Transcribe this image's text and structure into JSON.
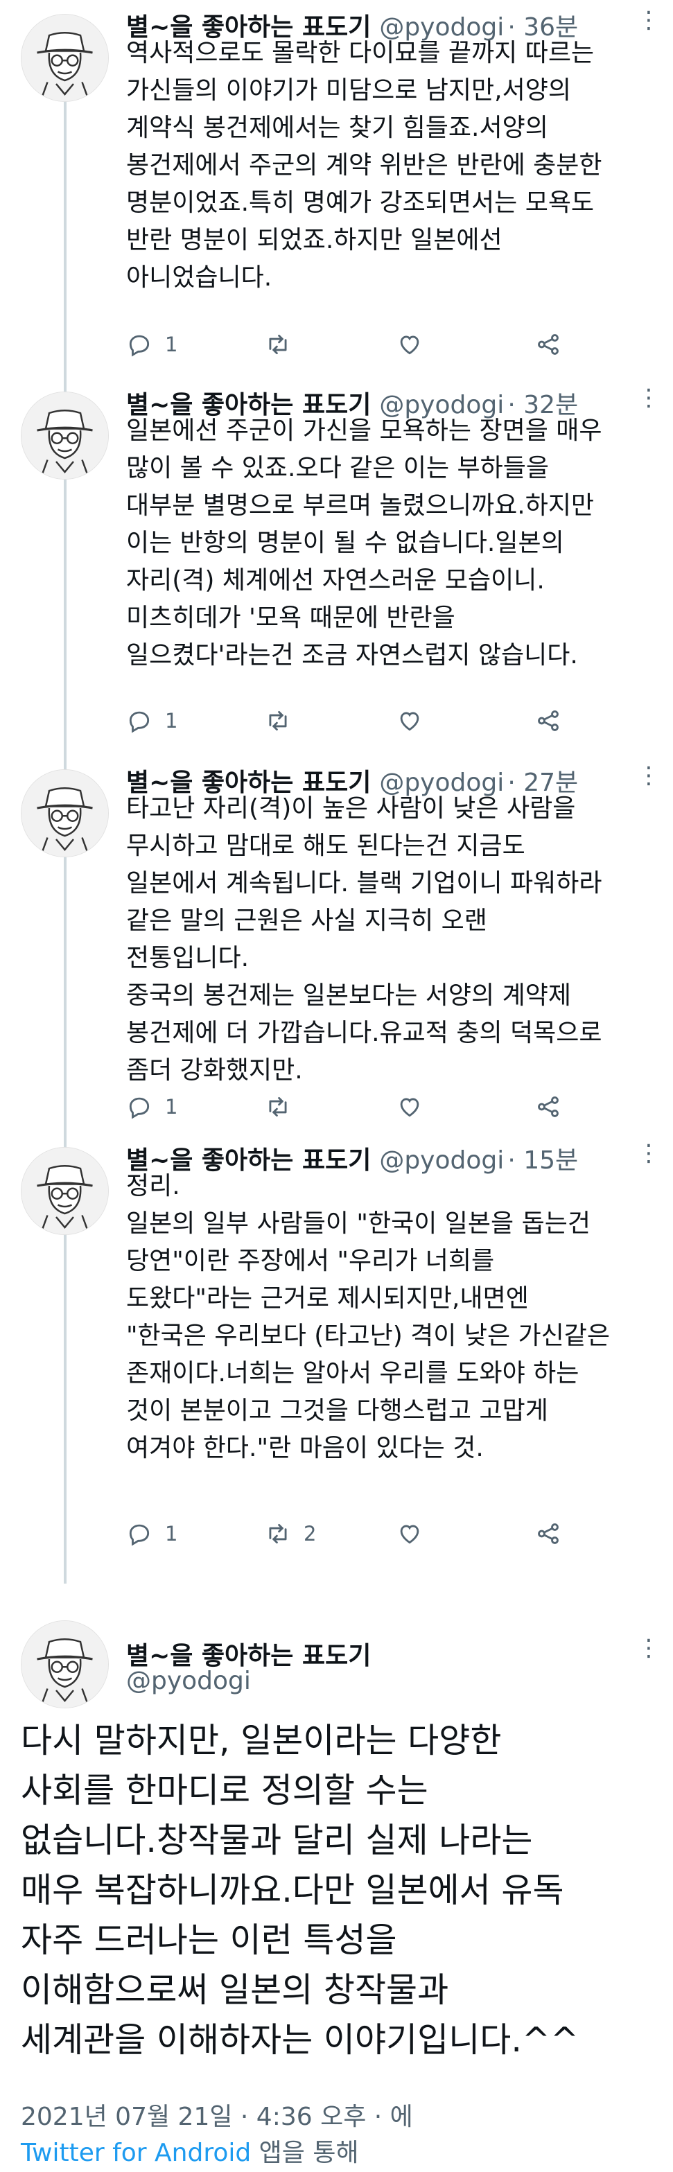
{
  "author": {
    "name": "별~을 좋아하는 표도기",
    "handle": "@pyodogi"
  },
  "tweets": [
    {
      "time": "· 36분",
      "text": "역사적으로도 몰락한 다이묘를 끝까지 따르는\n가신들의 이야기가 미담으로 남지만,서양의\n계약식 봉건제에서는 찾기 힘들죠.서양의\n봉건제에서 주군의 계약 위반은 반란에 충분한\n명분이었죠.특히 명예가 강조되면서는 모욕도\n반란 명분이 되었죠.하지만 일본에선\n아니었습니다.",
      "reply_count": "1",
      "retweet_count": "",
      "like_count": ""
    },
    {
      "time": "· 32분",
      "text": "일본에선 주군이 가신을 모욕하는 장면을 매우\n많이 볼 수 있죠.오다 같은 이는 부하들을\n대부분 별명으로 부르며 놀렸으니까요.하지만\n이는 반항의 명분이 될 수 없습니다.일본의\n자리(격) 체계에선 자연스러운 모습이니.\n미츠히데가 '모욕 때문에 반란을\n일으켰다'라는건 조금 자연스럽지 않습니다.",
      "reply_count": "1",
      "retweet_count": "",
      "like_count": ""
    },
    {
      "time": "· 27분",
      "text": "타고난 자리(격)이 높은 사람이 낮은 사람을\n무시하고 맘대로 해도 된다는건 지금도\n일본에서 계속됩니다. 블랙 기업이니 파워하라\n같은 말의 근원은 사실 지극히 오랜\n전통입니다.\n중국의 봉건제는 일본보다는 서양의 계약제\n봉건제에 더 가깝습니다.유교적 충의 덕목으로\n좀더 강화했지만.",
      "reply_count": "1",
      "retweet_count": "",
      "like_count": ""
    },
    {
      "time": "· 15분",
      "text": "정리.\n일본의 일부 사람들이 \"한국이 일본을 돕는건\n당연\"이란 주장에서 \"우리가 너희를\n도왔다\"라는 근거로 제시되지만,내면엔\n\"한국은 우리보다 (타고난) 격이 낮은 가신같은\n존재이다.너희는 알아서 우리를 도와야 하는\n것이 본분이고 그것을 다행스럽고 고맙게\n여겨야 한다.\"란 마음이 있다는 것.",
      "reply_count": "1",
      "retweet_count": "2",
      "like_count": ""
    }
  ],
  "main_tweet": {
    "text": "다시 말하지만, 일본이라는 다양한\n사회를 한마디로 정의할 수는\n없습니다.창작물과 달리 실제 나라는\n매우 복잡하니까요.다만 일본에서 유독\n자주 드러나는 이런 특성을\n이해함으로써 일본의 창작물과\n세계관을 이해하자는 이야기입니다.^^",
    "timestamp": "2021년 07월 21일 · 4:36 오후 · 에",
    "source": "Twitter for Android",
    "source_suffix": " 앱을 통해"
  },
  "icons": {
    "more": "more-vertical-icon",
    "reply": "reply-icon",
    "retweet": "retweet-icon",
    "like": "heart-icon",
    "share": "share-icon"
  },
  "colors": {
    "text": "#0f1419",
    "muted": "#536471",
    "link": "#1d9bf0",
    "thread_line": "#cfd9de"
  }
}
